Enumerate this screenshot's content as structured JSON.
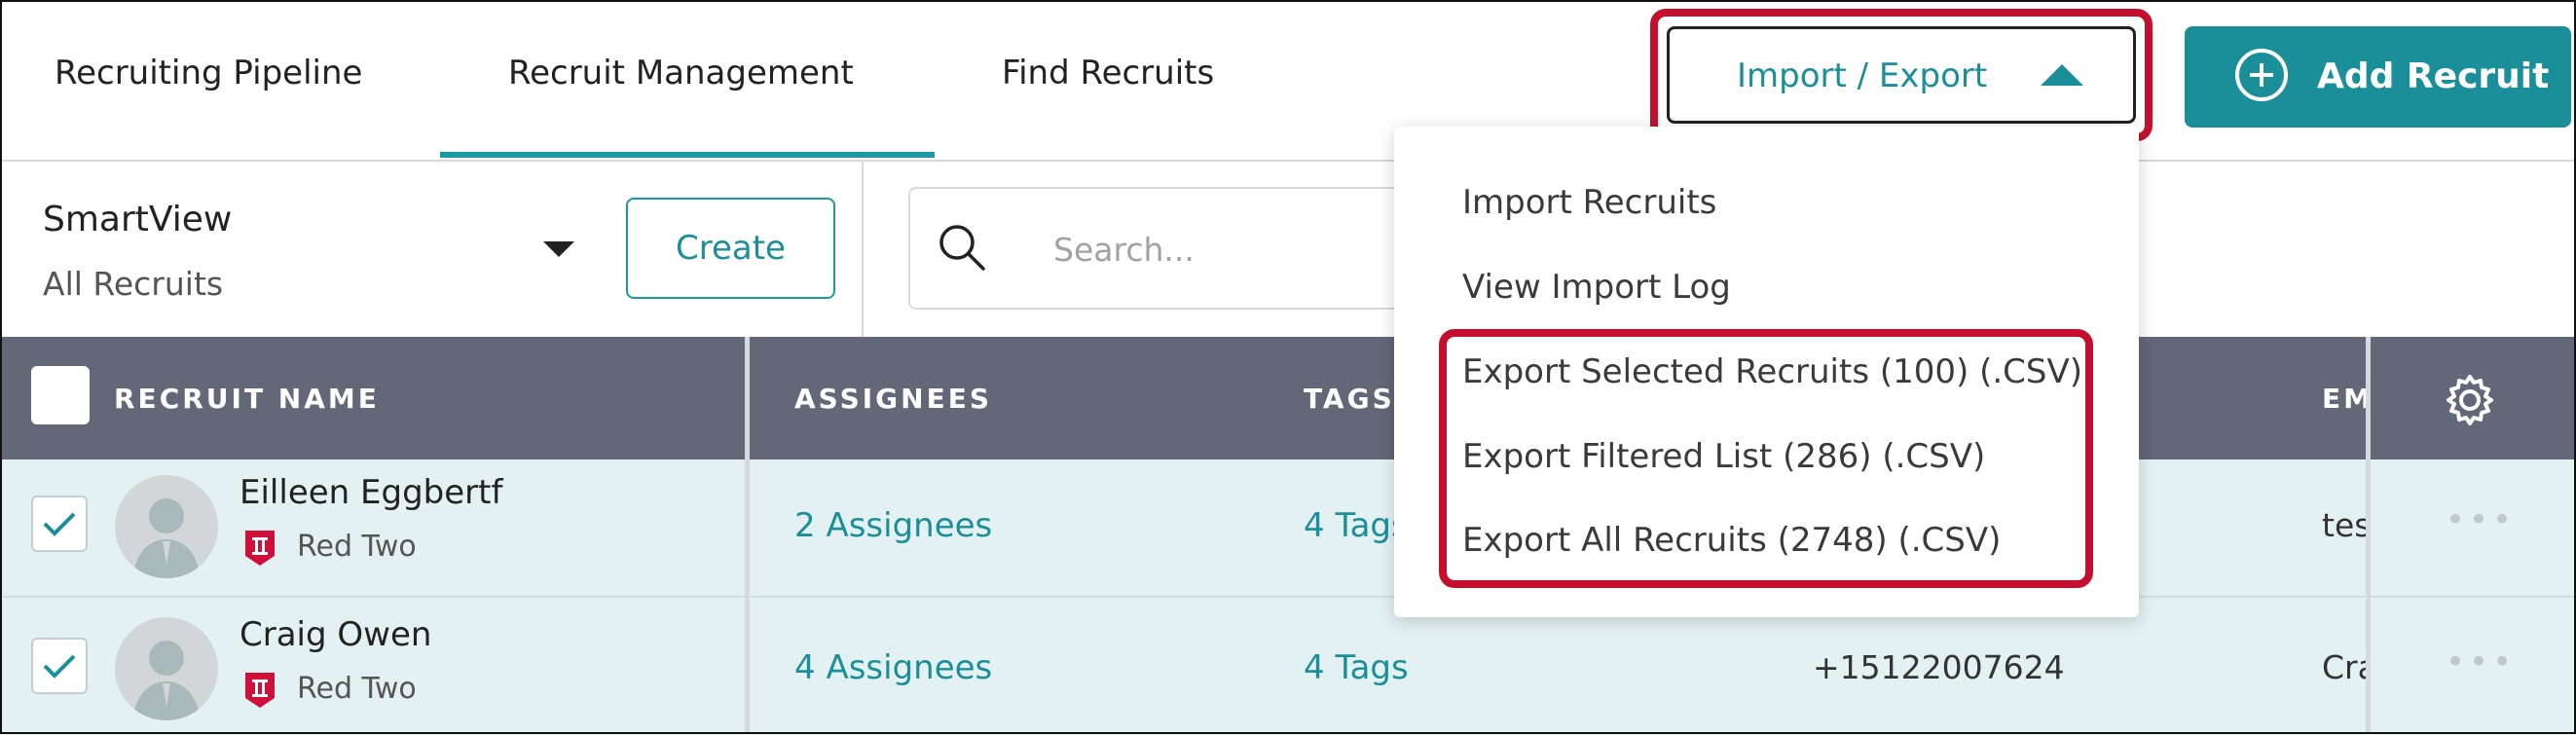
{
  "nav": {
    "tabs": [
      {
        "label": "Recruiting Pipeline"
      },
      {
        "label": "Recruit Management",
        "active": true
      },
      {
        "label": "Find Recruits"
      }
    ],
    "import_export_label": "Import / Export",
    "add_recruit_label": "Add Recruit"
  },
  "filters": {
    "smartview_title": "SmartView",
    "smartview_value": "All Recruits",
    "create_label": "Create",
    "search_placeholder": "Search..."
  },
  "table": {
    "headers": {
      "name": "RECRUIT NAME",
      "assignees": "ASSIGNEES",
      "tags": "TAGS",
      "email": "EM"
    },
    "rows": [
      {
        "name": "Eilleen Eggbertf",
        "badge": "Red Two",
        "assignees": "2 Assignees",
        "tags": "4 Tags",
        "phone": "",
        "email": "tes",
        "checked": true
      },
      {
        "name": "Craig Owen",
        "badge": "Red Two",
        "assignees": "4 Assignees",
        "tags": "4 Tags",
        "phone": "+15122007624",
        "email": "Cra",
        "checked": true
      }
    ],
    "row_menu_glyph": "•••"
  },
  "menu": {
    "items": [
      {
        "label": "Import Recruits"
      },
      {
        "label": "View Import Log"
      },
      {
        "label": "Export Selected Recruits (100) (.CSV)"
      },
      {
        "label": "Export Filtered List (286) (.CSV)"
      },
      {
        "label": "Export All Recruits (2748) (.CSV)"
      }
    ]
  },
  "colors": {
    "accent": "#1b8f99",
    "highlight": "#c4102e",
    "table_header": "#626878",
    "row_bg": "#e4f1f3",
    "badge": "#d0103a"
  },
  "icons": [
    "plus-circle-icon",
    "caret-up-icon",
    "caret-down-icon",
    "search-icon",
    "gear-icon",
    "checkmark-icon",
    "avatar-icon",
    "badge-icon"
  ]
}
